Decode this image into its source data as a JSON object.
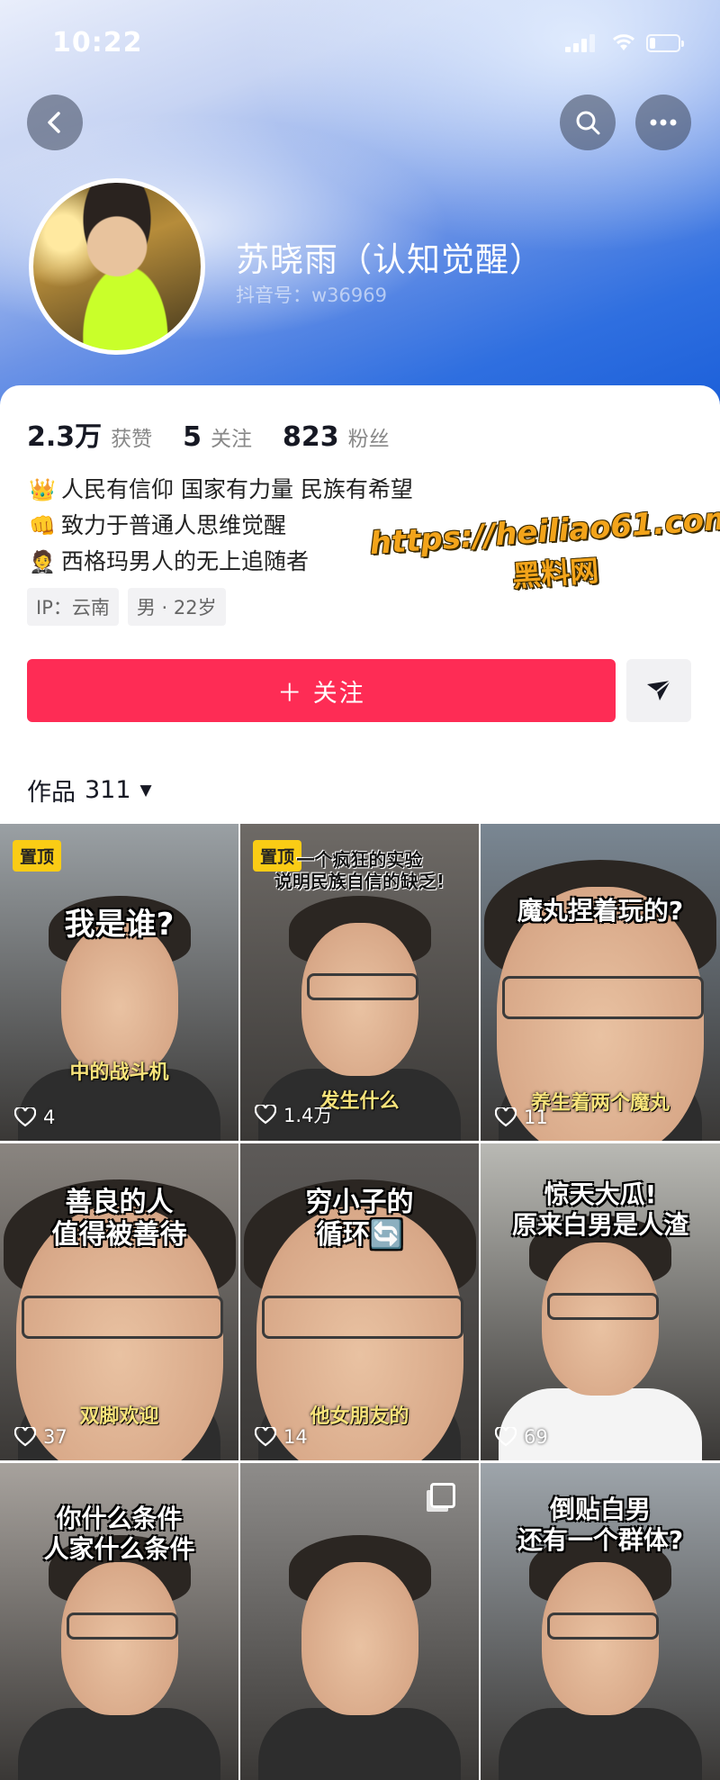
{
  "status_bar": {
    "time": "10:22",
    "battery_level": 0.2
  },
  "profile": {
    "name": "苏晓雨（认知觉醒）",
    "douyin_id": "抖音号：w36969",
    "stats": [
      {
        "value": "2.3万",
        "label": "获赞"
      },
      {
        "value": "5",
        "label": "关注"
      },
      {
        "value": "823",
        "label": "粉丝"
      }
    ],
    "bio": [
      {
        "icon": "👑",
        "text": "人民有信仰 国家有力量 民族有希望"
      },
      {
        "icon": "👊",
        "text": "致力于普通人思维觉醒"
      },
      {
        "icon": "🤵",
        "text": "西格玛男人的无上追随者"
      }
    ],
    "tags": [
      "IP：云南",
      "男 · 22岁"
    ]
  },
  "watermark": {
    "url": "https://heiliao61.com",
    "text": "黑料网"
  },
  "actions": {
    "follow_label": "＋ 关注"
  },
  "works": {
    "label": "作品",
    "count": "311",
    "caret": "▼"
  },
  "videos": [
    {
      "pinned": "置顶",
      "caption": "我是谁?",
      "sub": "中的战斗机",
      "likes": "4",
      "bg": "#9aa0a4"
    },
    {
      "pinned": "置顶",
      "caption": "一个疯狂的实验\n说明民族自信的缺乏!",
      "sub": "发生什么",
      "likes": "1.4万",
      "bg": "#6e6a66"
    },
    {
      "pinned": "",
      "caption": "魔丸捏着玩的?",
      "sub": "养生着两个魔丸",
      "likes": "11",
      "bg": "#7a8793"
    },
    {
      "pinned": "",
      "caption": "善良的人\n值得被善待",
      "sub": "双脚欢迎",
      "likes": "37",
      "bg": "#8a8580"
    },
    {
      "pinned": "",
      "caption": "穷小子的\n循环🔄",
      "sub": "他女朋友的",
      "likes": "14",
      "bg": "#5d5a58"
    },
    {
      "pinned": "",
      "caption": "惊天大瓜!\n原来白男是人渣",
      "sub": "",
      "likes": "69",
      "bg": "#b9b9b4"
    },
    {
      "pinned": "",
      "caption": "你什么条件\n人家什么条件",
      "sub": "",
      "likes": "",
      "bg": "#a7a29d"
    },
    {
      "pinned": "",
      "caption": "",
      "sub": "",
      "likes": "",
      "bg": "#8e8c8a"
    },
    {
      "pinned": "",
      "caption": "倒贴白男\n还有一个群体?",
      "sub": "",
      "likes": "",
      "bg": "#9ea5ab"
    }
  ],
  "colors": {
    "accent": "#fe2c55",
    "pin": "#facc15"
  }
}
